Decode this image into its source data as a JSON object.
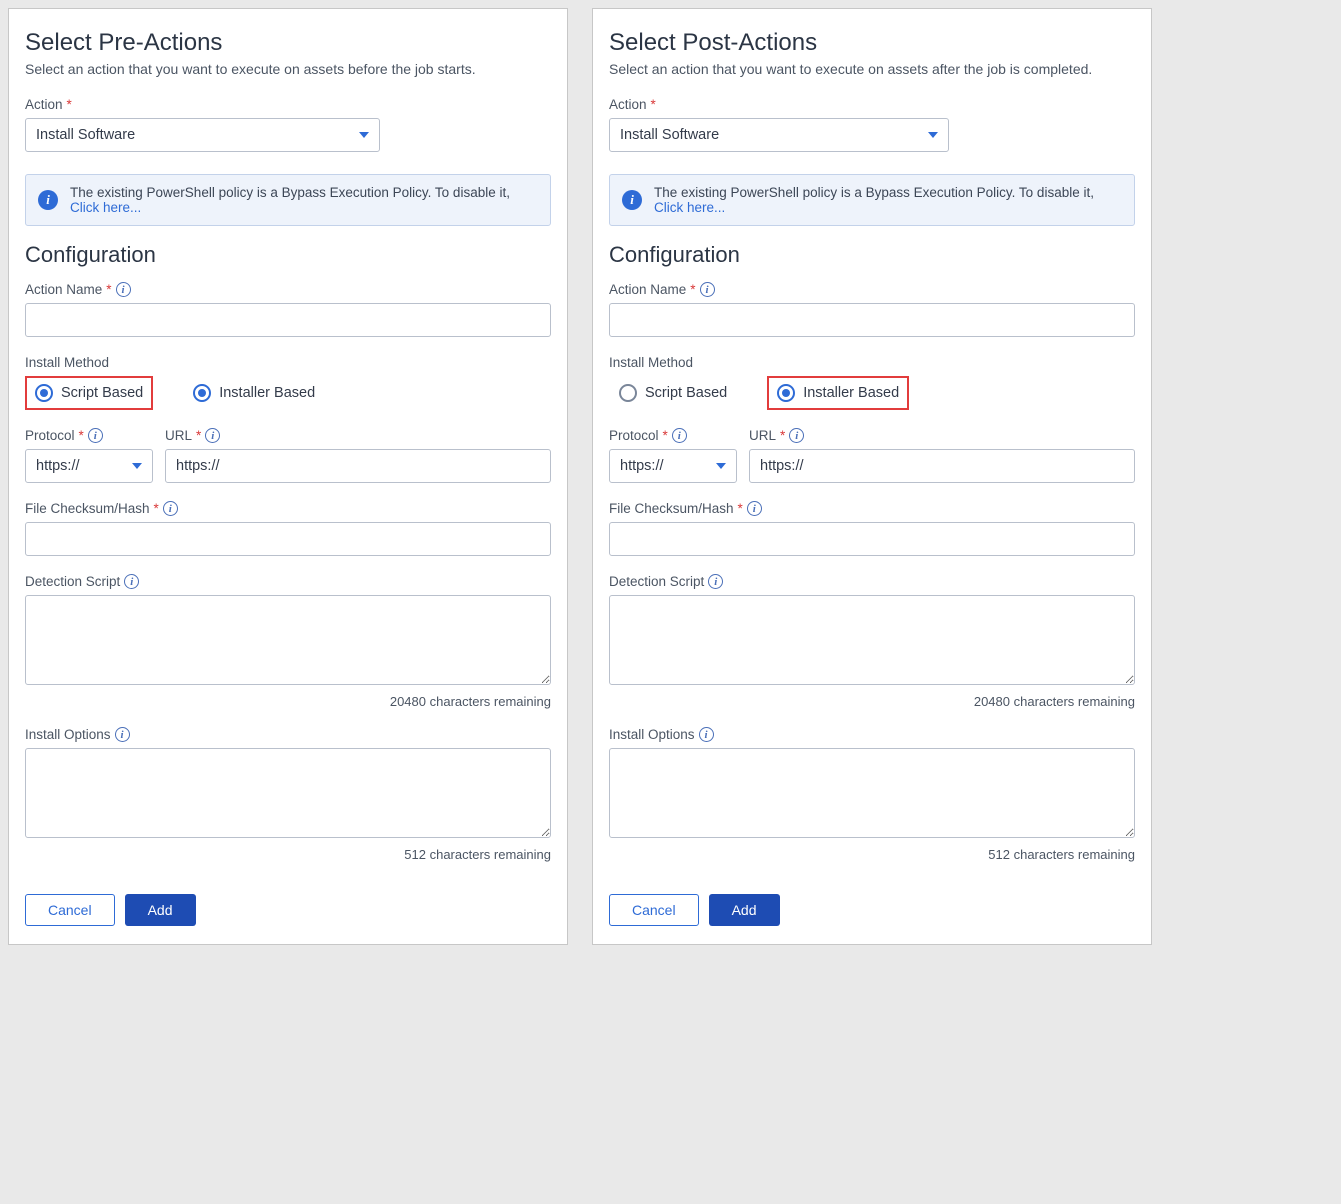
{
  "left": {
    "title": "Select Pre-Actions",
    "subtitle": "Select an action that you want to execute on assets before the job starts.",
    "action_label": "Action",
    "action_value": "Install Software",
    "banner_text": "The existing PowerShell policy is a Bypass Execution Policy. To disable it, ",
    "banner_link": "Click here...",
    "config_heading": "Configuration",
    "action_name_label": "Action Name",
    "install_method_label": "Install Method",
    "radio_script": "Script Based",
    "radio_installer": "Installer Based",
    "protocol_label": "Protocol",
    "protocol_value": "https://",
    "url_label": "URL",
    "url_value": "https://",
    "checksum_label": "File Checksum/Hash",
    "detection_label": "Detection Script",
    "detection_counter": "20480 characters remaining",
    "install_options_label": "Install Options",
    "install_options_counter": "512 characters remaining",
    "btn_cancel": "Cancel",
    "btn_add": "Add"
  },
  "right": {
    "title": "Select Post-Actions",
    "subtitle": "Select an action that you want to execute on assets after the job is completed.",
    "action_label": "Action",
    "action_value": "Install Software",
    "banner_text": "The existing PowerShell policy is a Bypass Execution Policy. To disable it, ",
    "banner_link": "Click here...",
    "config_heading": "Configuration",
    "action_name_label": "Action Name",
    "install_method_label": "Install Method",
    "radio_script": "Script Based",
    "radio_installer": "Installer Based",
    "protocol_label": "Protocol",
    "protocol_value": "https://",
    "url_label": "URL",
    "url_value": "https://",
    "checksum_label": "File Checksum/Hash",
    "detection_label": "Detection Script",
    "detection_counter": "20480 characters remaining",
    "install_options_label": "Install Options",
    "install_options_counter": "512 characters remaining",
    "btn_cancel": "Cancel",
    "btn_add": "Add"
  }
}
